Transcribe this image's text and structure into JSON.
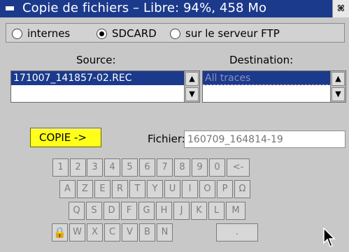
{
  "window": {
    "title": "Copie de fichiers – Libre: 94%, 458 Mo",
    "resize_glyph": "⌘"
  },
  "radio": {
    "options": [
      {
        "label": "internes",
        "selected": false
      },
      {
        "label": "SDCARD",
        "selected": true
      },
      {
        "label": "sur le serveur FTP",
        "selected": false
      }
    ]
  },
  "source": {
    "label": "Source:",
    "items": [
      "171007_141857-02.REC"
    ],
    "selected_index": 0
  },
  "destination": {
    "label": "Destination:",
    "items": [
      "All traces"
    ]
  },
  "scroll": {
    "up": "▲",
    "down": "▼"
  },
  "copy": {
    "label": "COPIE ->"
  },
  "file": {
    "label": "Fichier:",
    "placeholder": "160709_164814-19"
  },
  "keyboard": {
    "rows": [
      [
        "1",
        "2",
        "3",
        "4",
        "5",
        "6",
        "7",
        "8",
        "9",
        "0",
        "<-"
      ],
      [
        "A",
        "Z",
        "E",
        "R",
        "T",
        "Y",
        "U",
        "I",
        "O",
        "P",
        "Ω"
      ],
      [
        "Q",
        "S",
        "D",
        "F",
        "G",
        "H",
        "J",
        "K",
        "L",
        "M"
      ],
      [
        "🔒",
        "W",
        "X",
        "C",
        "V",
        "B",
        "N",
        "."
      ]
    ]
  },
  "colors": {
    "titlebar": "#1c3a8c",
    "selection": "#1c3a8c",
    "copy_button": "#ffff1a",
    "window_bg": "#c8c8c8"
  }
}
